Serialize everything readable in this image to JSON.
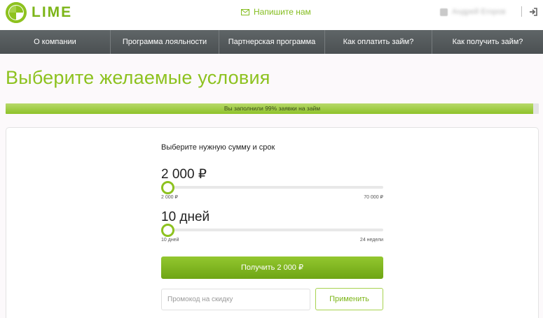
{
  "header": {
    "logo_text": "LIME",
    "write_us_label": "Напишите нам",
    "user_name": "Андрей Егоров"
  },
  "nav": {
    "items": [
      {
        "label": "О компании"
      },
      {
        "label": "Программа лояльности"
      },
      {
        "label": "Партнерская программа"
      },
      {
        "label": "Как оплатить займ?"
      },
      {
        "label": "Как получить займ?"
      }
    ]
  },
  "page": {
    "title": "Выберите желаемые условия"
  },
  "progress": {
    "label": "Вы заполнили 99% заявки на займ",
    "percent": 99
  },
  "form": {
    "heading": "Выберите нужную сумму и срок",
    "amount": {
      "value": "2 000 ₽",
      "min_label": "2 000 ₽",
      "max_label": "70 000 ₽",
      "fraction": 0
    },
    "term": {
      "value": "10 дней",
      "min_label": "10 дней",
      "max_label": "24 недели",
      "fraction": 0
    },
    "submit_label": "Получить 2 000 ₽",
    "promo_placeholder": "Промокод на скидку",
    "promo_value": "",
    "apply_label": "Применить"
  },
  "colors": {
    "accent": "#8dc21f",
    "nav_bg": "#575c5e",
    "progress_fill": "#99c93c"
  },
  "icons": {
    "logo": "lime-logo-icon",
    "mail": "envelope-icon",
    "logout": "logout-icon"
  }
}
